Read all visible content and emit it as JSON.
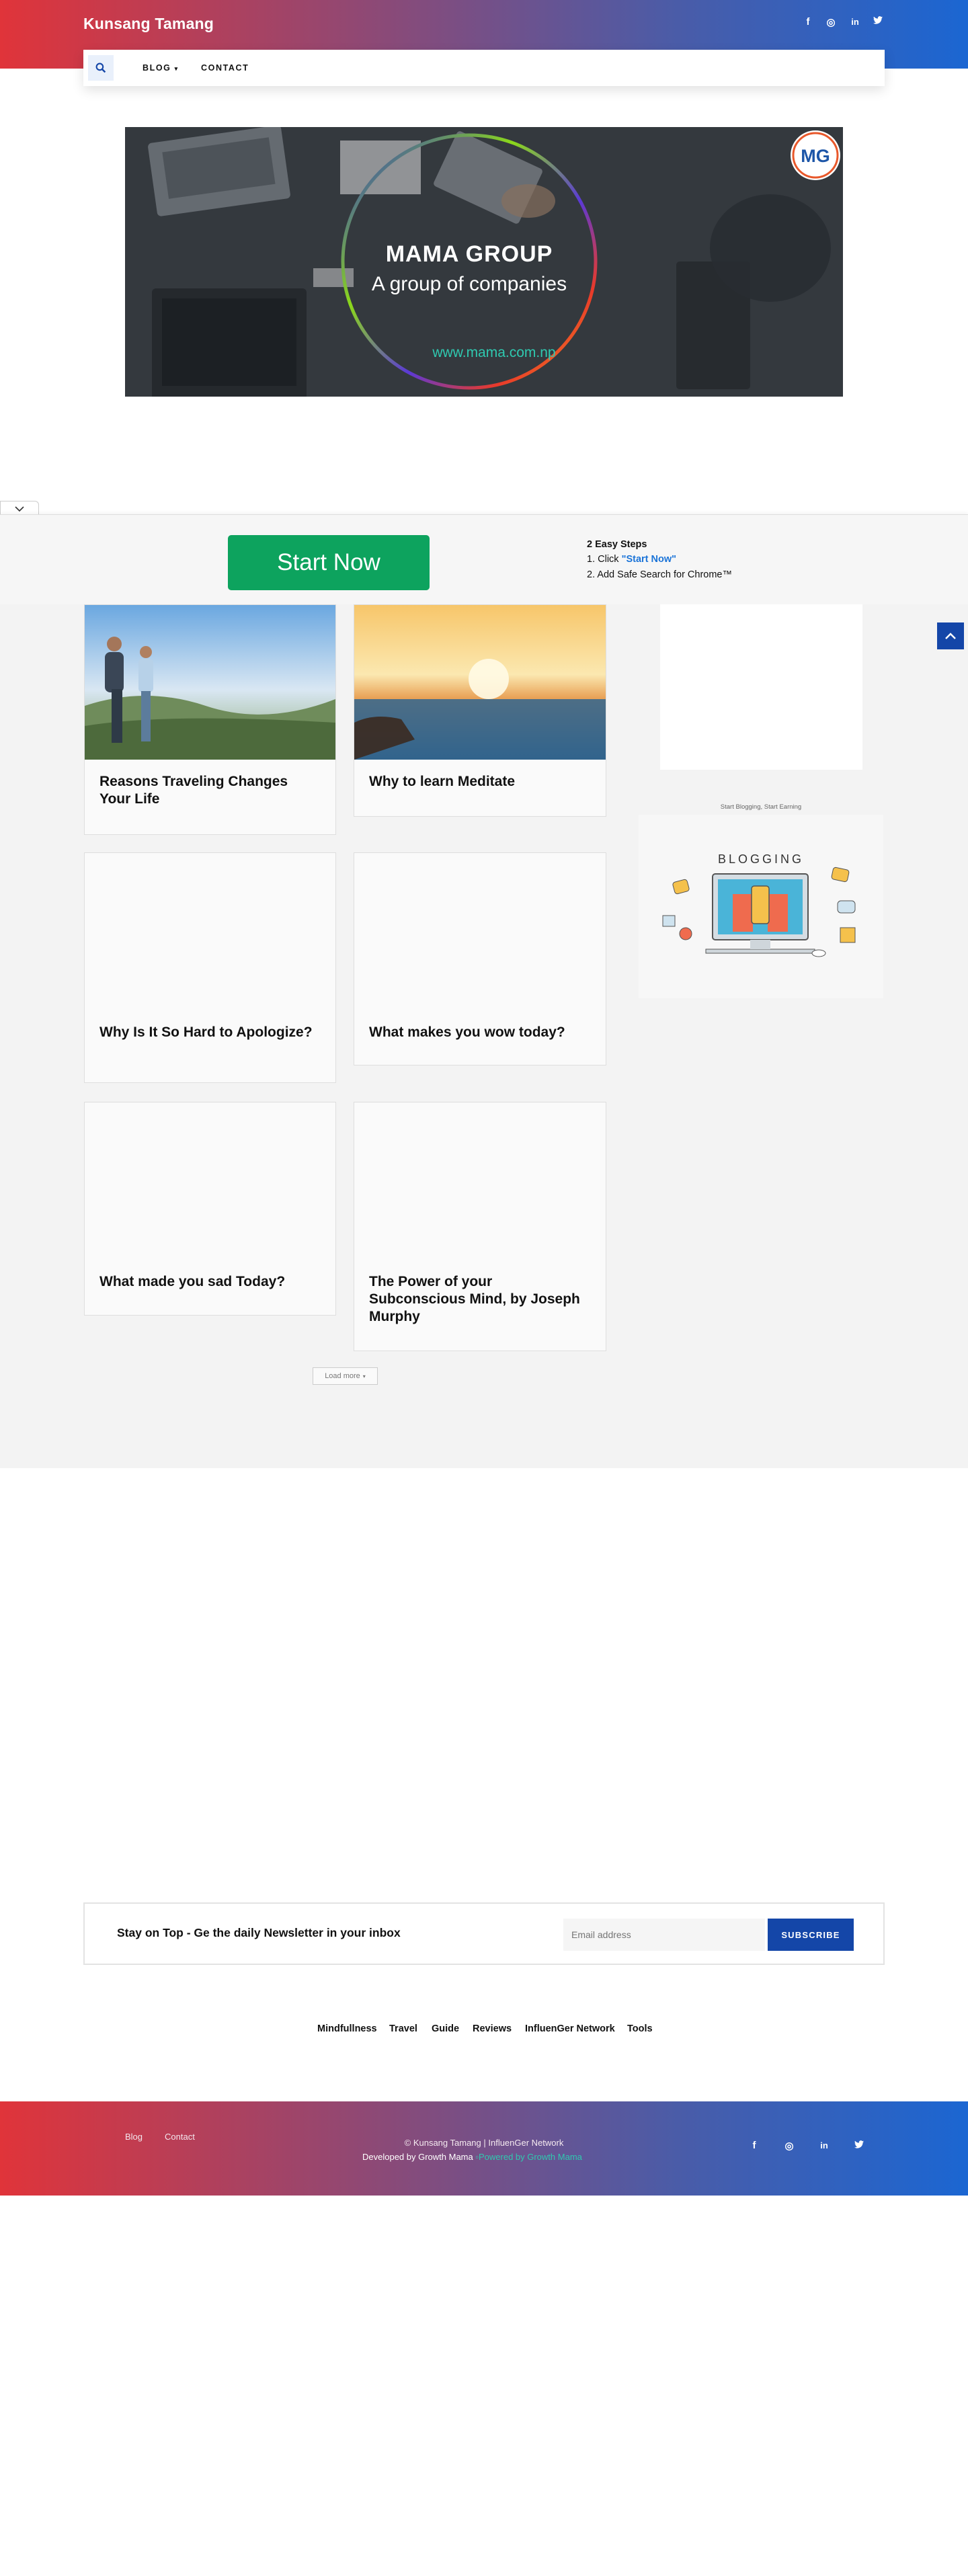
{
  "header": {
    "site_title": "Kunsang Tamang",
    "social": [
      "f",
      "◎",
      "in",
      "🐦"
    ]
  },
  "nav": {
    "blog_label": "BLOG",
    "blog_caret": "▾",
    "contact_label": "CONTACT",
    "search_icon": "search-icon"
  },
  "banner": {
    "brand": "MAMA GROUP",
    "tagline": "A group of companies",
    "url": "www.mama.com.np",
    "logo": "MG"
  },
  "promo": {
    "button_label": "Start Now",
    "steps_title": "2 Easy Steps",
    "step1_prefix": "1. Click ",
    "step1_link": "\"Start Now\"",
    "step2": "2. Add Safe Search for Chrome™"
  },
  "posts": [
    {
      "title": "Reasons Traveling Changes Your Life"
    },
    {
      "title": "Why to learn Meditate"
    },
    {
      "title": "Why Is It So Hard to Apologize?"
    },
    {
      "title": "What makes you wow today?"
    },
    {
      "title": "What made you sad Today?"
    },
    {
      "title": "The Power of your Subconscious Mind, by Joseph Murphy"
    }
  ],
  "sidebar": {
    "ad_caption": "Start Blogging, Start Earning",
    "ad_word": "BLOGGING"
  },
  "load_more": {
    "label": "Load more",
    "caret": "▾"
  },
  "newsletter": {
    "text": "Stay on Top - Ge the daily Newsletter in your inbox",
    "placeholder": "Email address",
    "button": "SUBSCRIBE"
  },
  "footer_categories": [
    "Mindfullness",
    "Travel",
    "Guide",
    "Reviews",
    "InfluenGer Network",
    "Tools"
  ],
  "footer": {
    "links": [
      "Blog",
      "Contact"
    ],
    "copyright": "© Kunsang Tamang | InfluenGer Network",
    "developed_by": "Developed by Growth Mama",
    "powered_by": "Powered by Growth Mama",
    "social": [
      "f",
      "◎",
      "in",
      "🐦"
    ]
  },
  "colors": {
    "brand_blue": "#1446a8",
    "start_green": "#0da35e",
    "gradient_start": "#e0343a",
    "gradient_end": "#1b66d2"
  }
}
